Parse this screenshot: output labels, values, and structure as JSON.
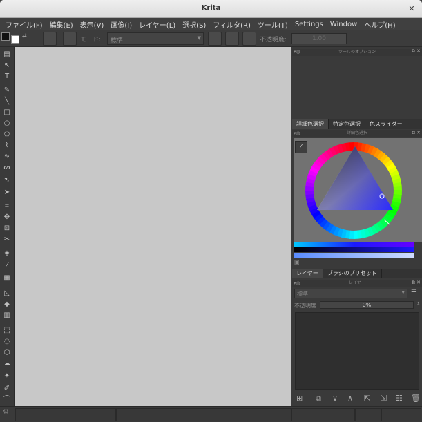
{
  "window": {
    "title": "Krita"
  },
  "menu": [
    "ファイル(F)",
    "編集(E)",
    "表示(V)",
    "画像(I)",
    "レイヤー(L)",
    "選択(S)",
    "フィルタ(R)",
    "ツール(T)",
    "Settings",
    "Window",
    "ヘルプ(H)"
  ],
  "toolbar": {
    "mode_label": "モード:",
    "blend_mode": "標準",
    "opacity_label": "不透明度:",
    "opacity_value": "1.00"
  },
  "tool_options": {
    "title": "ツールのオプション"
  },
  "color_tabs": [
    "詳細色選択",
    "特定色選択",
    "色スライダー"
  ],
  "color_selector": {
    "title": "詳細色選択"
  },
  "layer_tabs": [
    "レイヤー",
    "ブラシのプリセット"
  ],
  "layers": {
    "title": "レイヤー",
    "blend_mode": "標準",
    "opacity_label": "不透明度:",
    "opacity_value": "0%"
  },
  "colors": {
    "accent": "#1a1aff",
    "canvas": "#c8c8c8",
    "panel": "#3a3a3a"
  }
}
